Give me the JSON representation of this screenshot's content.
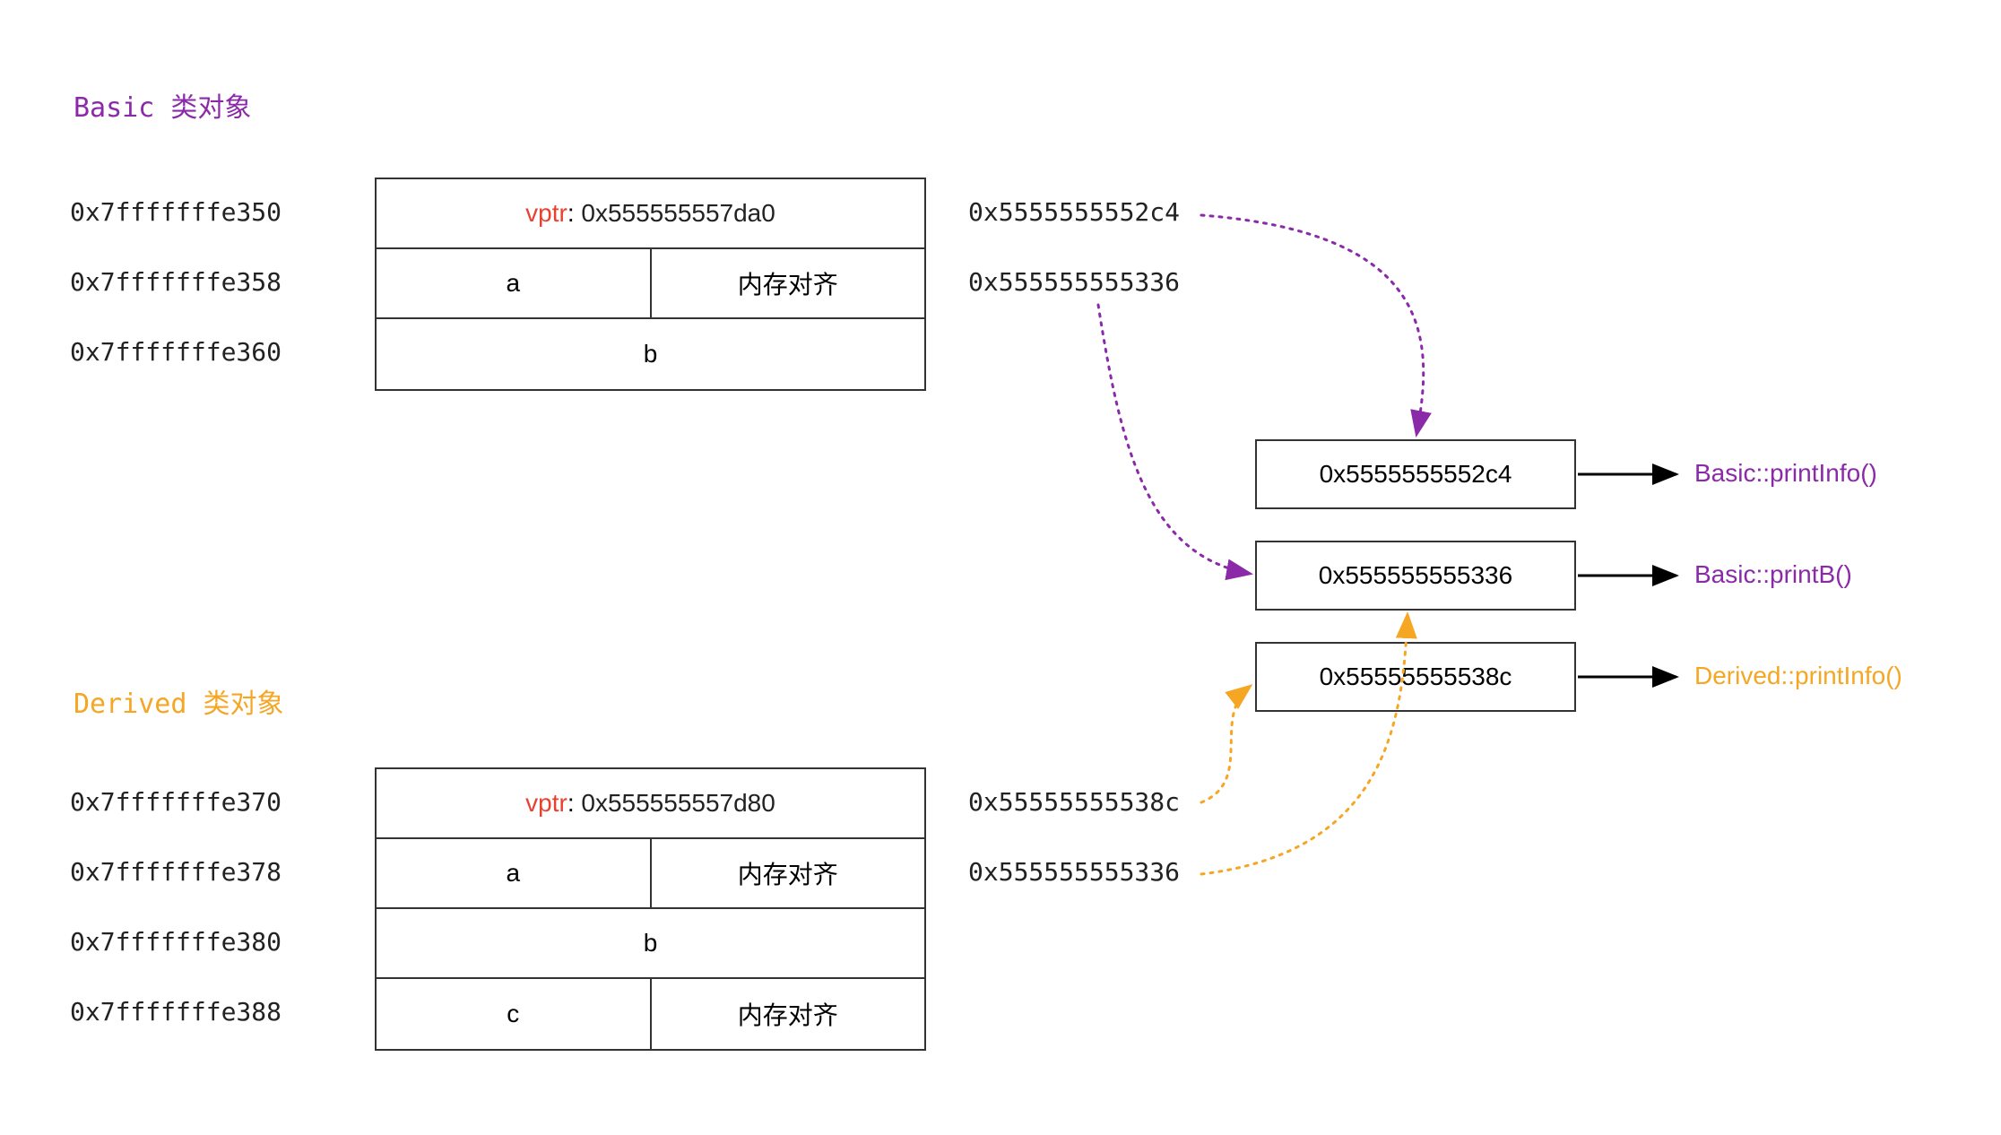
{
  "basic": {
    "title": "Basic 类对象",
    "addrs": [
      "0x7fffffffe350",
      "0x7fffffffe358",
      "0x7fffffffe360"
    ],
    "vptr_label": "vptr",
    "vptr_value": "0x555555557da0",
    "field_a": "a",
    "padding": "内存对齐",
    "field_b": "b",
    "vtable_entries": [
      "0x5555555552c4",
      "0x555555555336"
    ]
  },
  "derived": {
    "title": "Derived 类对象",
    "addrs": [
      "0x7fffffffe370",
      "0x7fffffffe378",
      "0x7fffffffe380",
      "0x7fffffffe388"
    ],
    "vptr_label": "vptr",
    "vptr_value": "0x555555557d80",
    "field_a": "a",
    "padding": "内存对齐",
    "field_b": "b",
    "field_c": "c",
    "padding2": "内存对齐",
    "vtable_entries": [
      "0x55555555538c",
      "0x555555555336"
    ]
  },
  "functions": [
    {
      "addr": "0x5555555552c4",
      "label": "Basic::printInfo()"
    },
    {
      "addr": "0x555555555336",
      "label": "Basic::printB()"
    },
    {
      "addr": "0x55555555538c",
      "label": "Derived::printInfo()"
    }
  ],
  "colors": {
    "purple": "#8b2aa8",
    "orange": "#f5a623",
    "red": "#e8412f"
  }
}
